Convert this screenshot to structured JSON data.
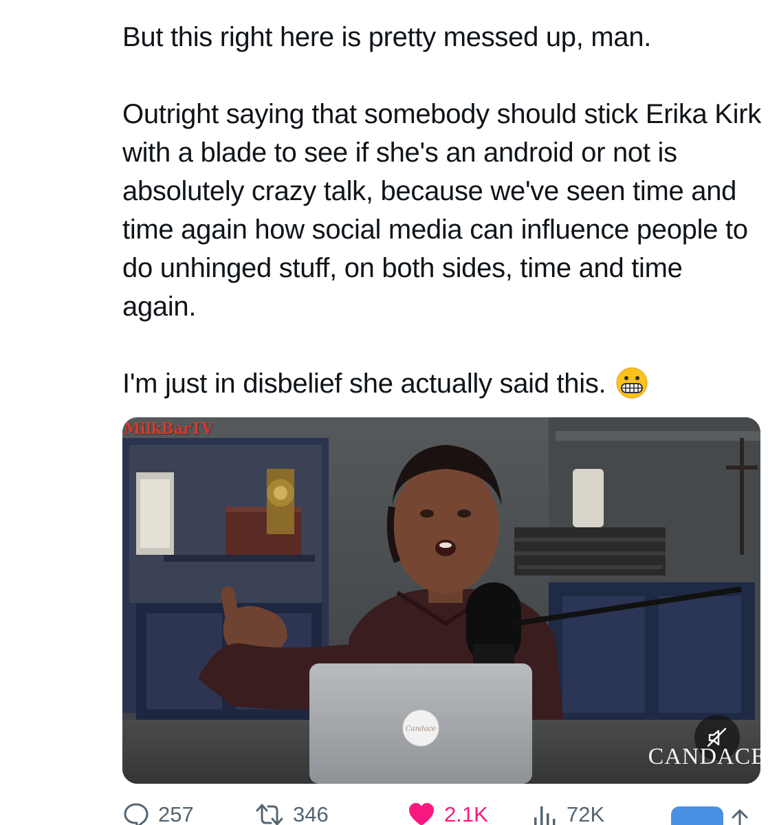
{
  "post": {
    "paragraphs": [
      "But this right here is pretty messed up, man.",
      "Outright saying that somebody should stick Erika Kirk with a blade to see if she's an android or not is absolutely crazy talk, because we've seen time and time again how social media can influence people to do unhinged stuff, on both sides, time and time again.",
      "I'm just in disbelief she actually said this."
    ],
    "emoji": "grimacing-face"
  },
  "media": {
    "watermark": "MilkBarTV",
    "brand_overlay": "CANDACE",
    "mute_icon": "muted-speaker-icon",
    "laptop_sticker_text": "Candace"
  },
  "actions": {
    "replies": "257",
    "reposts": "346",
    "likes": "2.1K",
    "views": "72K"
  },
  "colors": {
    "text": "#0f1419",
    "muted": "#536471",
    "like": "#f91880",
    "accent": "#1d9bf0",
    "watermark": "#d33a2c"
  }
}
